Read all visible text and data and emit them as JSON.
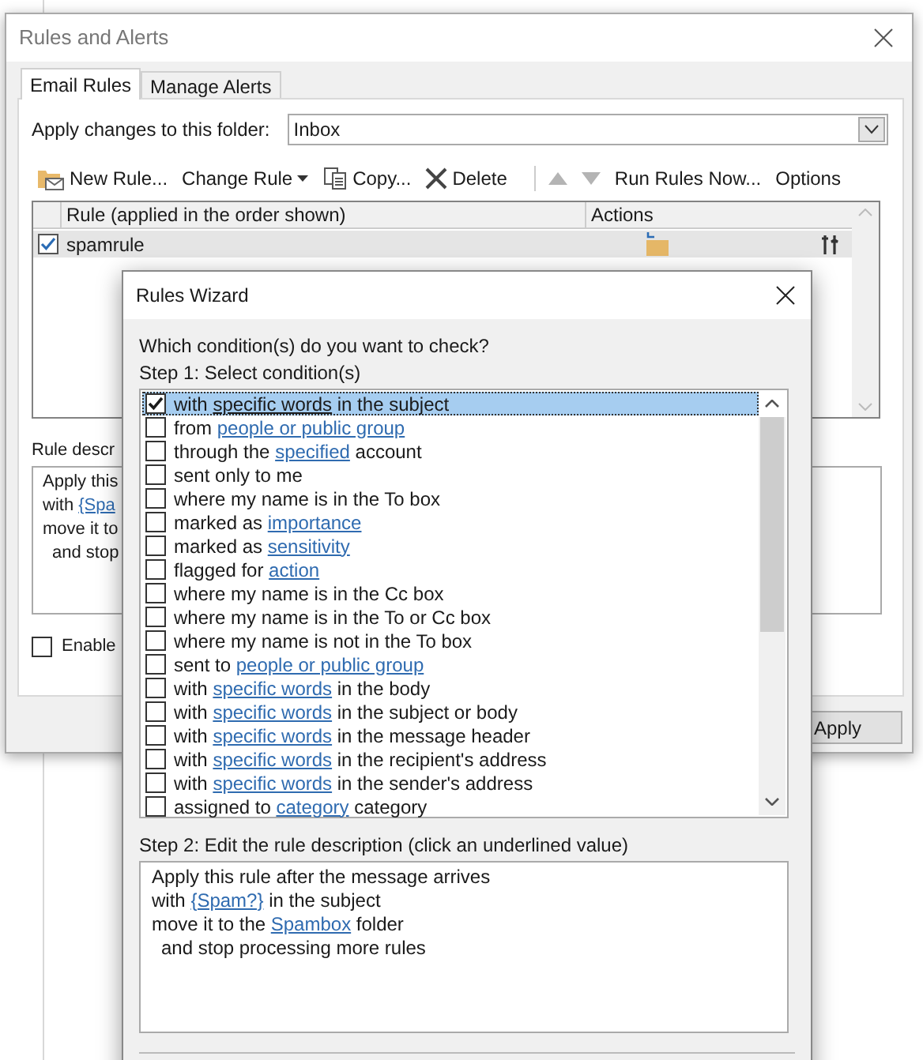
{
  "background_window": {
    "title": "Rules and Alerts",
    "tabs": [
      {
        "label": "Email Rules",
        "selected": true
      },
      {
        "label": "Manage Alerts",
        "selected": false
      }
    ],
    "folder_label": "Apply changes to this folder:",
    "folder_value": "Inbox",
    "toolbar": [
      {
        "kind": "new",
        "label": "New Rule..."
      },
      {
        "kind": "change",
        "label": "Change Rule"
      },
      {
        "kind": "copy",
        "label": "Copy..."
      },
      {
        "kind": "delete",
        "label": "Delete"
      },
      {
        "kind": "up",
        "disabled": true
      },
      {
        "kind": "down",
        "disabled": true
      },
      {
        "kind": "text",
        "label": "Run Rules Now..."
      },
      {
        "kind": "text",
        "label": "Options"
      }
    ],
    "rules_table": {
      "columns": [
        "Rule (applied in the order shown)",
        "Actions"
      ],
      "rows": [
        {
          "name": "spamrule",
          "checked": true,
          "selected": true
        }
      ]
    },
    "description_label": "Rule descr",
    "description_lines": [
      {
        "parts": [
          {
            "text": "Apply this"
          }
        ]
      },
      {
        "parts": [
          {
            "text": "with "
          },
          {
            "text": "{Spa",
            "link": true
          }
        ]
      },
      {
        "parts": [
          {
            "text": "move it to"
          }
        ]
      },
      {
        "parts": [
          {
            "text": "and stop"
          }
        ],
        "indented": true
      }
    ],
    "enable_label": "Enable",
    "enable_checked": false,
    "apply_button": "Apply"
  },
  "wizard": {
    "title": "Rules Wizard",
    "question": "Which condition(s) do you want to check?",
    "step1": "Step 1: Select condition(s)",
    "conditions": [
      {
        "parts": [
          {
            "text": "with "
          },
          {
            "text": "specific words",
            "link": true
          },
          {
            "text": " in the subject"
          }
        ],
        "checked": true,
        "selected": true
      },
      {
        "parts": [
          {
            "text": "from "
          },
          {
            "text": "people or public group",
            "link": true
          }
        ],
        "checked": false,
        "selected": false
      },
      {
        "parts": [
          {
            "text": "through the "
          },
          {
            "text": "specified",
            "link": true
          },
          {
            "text": " account"
          }
        ],
        "checked": false,
        "selected": false
      },
      {
        "parts": [
          {
            "text": "sent only to me"
          }
        ],
        "checked": false,
        "selected": false
      },
      {
        "parts": [
          {
            "text": "where my name is in the To box"
          }
        ],
        "checked": false,
        "selected": false
      },
      {
        "parts": [
          {
            "text": "marked as "
          },
          {
            "text": "importance",
            "link": true
          }
        ],
        "checked": false,
        "selected": false
      },
      {
        "parts": [
          {
            "text": "marked as "
          },
          {
            "text": "sensitivity",
            "link": true
          }
        ],
        "checked": false,
        "selected": false
      },
      {
        "parts": [
          {
            "text": "flagged for "
          },
          {
            "text": "action",
            "link": true
          }
        ],
        "checked": false,
        "selected": false
      },
      {
        "parts": [
          {
            "text": "where my name is in the Cc box"
          }
        ],
        "checked": false,
        "selected": false
      },
      {
        "parts": [
          {
            "text": "where my name is in the To or Cc box"
          }
        ],
        "checked": false,
        "selected": false
      },
      {
        "parts": [
          {
            "text": "where my name is not in the To box"
          }
        ],
        "checked": false,
        "selected": false
      },
      {
        "parts": [
          {
            "text": "sent to "
          },
          {
            "text": "people or public group",
            "link": true
          }
        ],
        "checked": false,
        "selected": false
      },
      {
        "parts": [
          {
            "text": "with "
          },
          {
            "text": "specific words",
            "link": true
          },
          {
            "text": " in the body"
          }
        ],
        "checked": false,
        "selected": false
      },
      {
        "parts": [
          {
            "text": "with "
          },
          {
            "text": "specific words",
            "link": true
          },
          {
            "text": " in the subject or body"
          }
        ],
        "checked": false,
        "selected": false
      },
      {
        "parts": [
          {
            "text": "with "
          },
          {
            "text": "specific words",
            "link": true
          },
          {
            "text": " in the message header"
          }
        ],
        "checked": false,
        "selected": false
      },
      {
        "parts": [
          {
            "text": "with "
          },
          {
            "text": "specific words",
            "link": true
          },
          {
            "text": " in the recipient's address"
          }
        ],
        "checked": false,
        "selected": false
      },
      {
        "parts": [
          {
            "text": "with "
          },
          {
            "text": "specific words",
            "link": true
          },
          {
            "text": " in the sender's address"
          }
        ],
        "checked": false,
        "selected": false
      },
      {
        "parts": [
          {
            "text": "assigned to "
          },
          {
            "text": "category",
            "link": true
          },
          {
            "text": " category"
          }
        ],
        "checked": false,
        "selected": false
      }
    ],
    "step2": "Step 2: Edit the rule description (click an underlined value)",
    "description_lines": [
      {
        "parts": [
          {
            "text": "Apply this rule after the message arrives"
          }
        ]
      },
      {
        "parts": [
          {
            "text": "with "
          },
          {
            "text": "{Spam?}",
            "link": true
          },
          {
            "text": " in the subject"
          }
        ]
      },
      {
        "parts": [
          {
            "text": "move it to the "
          },
          {
            "text": "Spambox",
            "link": true
          },
          {
            "text": " folder"
          }
        ]
      },
      {
        "parts": [
          {
            "text": "and stop processing more rules"
          }
        ],
        "indented": true
      }
    ]
  }
}
